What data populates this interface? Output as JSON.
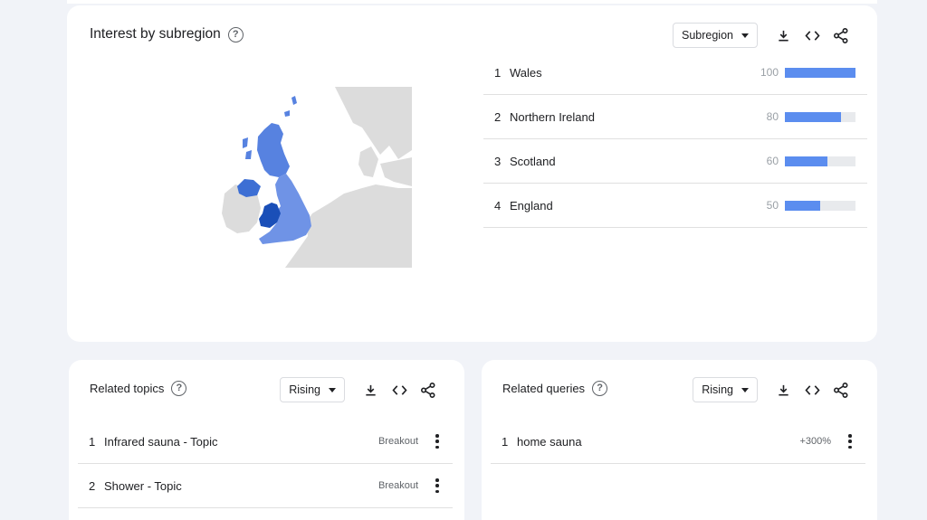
{
  "main_card": {
    "title": "Interest by subregion",
    "dropdown": "Subregion",
    "regions": [
      {
        "rank": "1",
        "name": "Wales",
        "value": "100",
        "level": 100
      },
      {
        "rank": "2",
        "name": "Northern Ireland",
        "value": "80",
        "level": 80
      },
      {
        "rank": "3",
        "name": "Scotland",
        "value": "60",
        "level": 60
      },
      {
        "rank": "4",
        "name": "England",
        "value": "50",
        "level": 50
      }
    ]
  },
  "topics_card": {
    "title": "Related topics",
    "dropdown": "Rising",
    "items": [
      {
        "rank": "1",
        "name": "Infrared sauna - Topic",
        "value": "Breakout"
      },
      {
        "rank": "2",
        "name": "Shower - Topic",
        "value": "Breakout"
      }
    ]
  },
  "queries_card": {
    "title": "Related queries",
    "dropdown": "Rising",
    "items": [
      {
        "rank": "1",
        "name": "home sauna",
        "value": "+300%"
      }
    ]
  },
  "icons": {
    "help": "help-circle-icon",
    "download": "download-icon",
    "embed": "code-icon",
    "share": "share-icon",
    "more": "more-vert-icon"
  },
  "colors": {
    "bar": "#5b8def",
    "wales": "#1a4fb8",
    "northern_ireland": "#3d6fd4",
    "scotland": "#5782e0",
    "england": "#6f93e6",
    "land_other": "#dcdcdc"
  }
}
